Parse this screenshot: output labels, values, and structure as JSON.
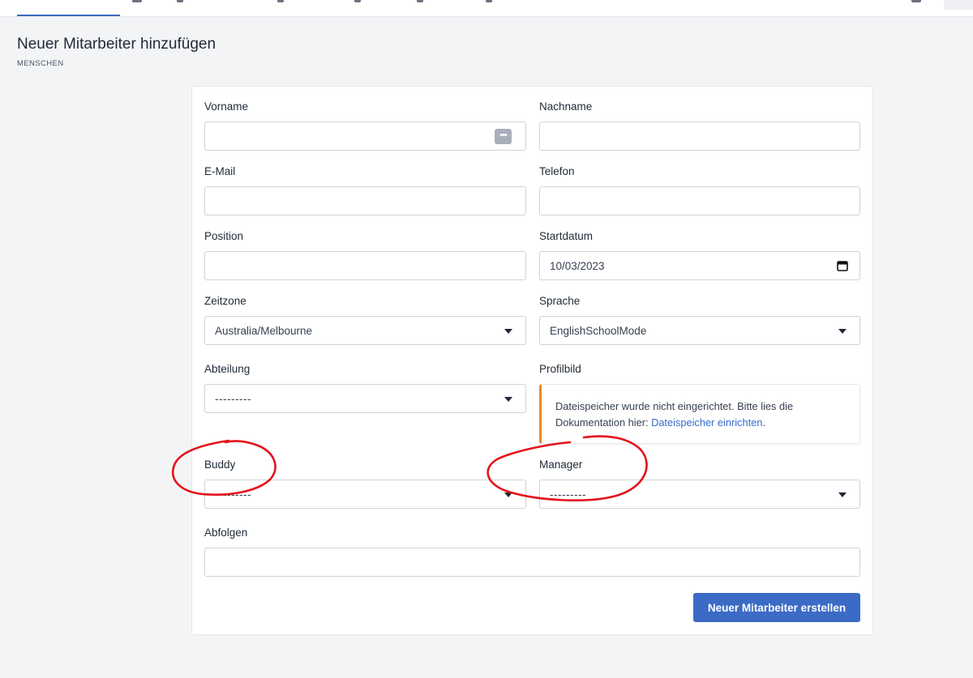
{
  "header": {
    "title": "Neuer Mitarbeiter hinzufügen",
    "breadcrumb": "MENSCHEN"
  },
  "form": {
    "first_name": {
      "label": "Vorname",
      "value": "",
      "icon": "password-manager-icon"
    },
    "last_name": {
      "label": "Nachname",
      "value": ""
    },
    "email": {
      "label": "E-Mail",
      "value": ""
    },
    "phone": {
      "label": "Telefon",
      "value": ""
    },
    "position": {
      "label": "Position",
      "value": ""
    },
    "start_date": {
      "label": "Startdatum",
      "value": "10/03/2023",
      "icon": "calendar-icon"
    },
    "timezone": {
      "label": "Zeitzone",
      "value": "Australia/Melbourne"
    },
    "language": {
      "label": "Sprache",
      "value": "EnglishSchoolMode"
    },
    "department": {
      "label": "Abteilung",
      "value": "---------"
    },
    "profile_picture": {
      "label": "Profilbild",
      "alert_text": "Dateispeicher wurde nicht eingerichtet. Bitte lies die Dokumentation hier: ",
      "alert_link": "Dateispeicher einrichten",
      "alert_end": ".",
      "alert_color": "#e98b1e"
    },
    "buddy": {
      "label": "Buddy",
      "value": "---------"
    },
    "manager": {
      "label": "Manager",
      "value": "---------"
    },
    "sequences": {
      "label": "Abfolgen",
      "value": ""
    },
    "submit_label": "Neuer Mitarbeiter erstellen"
  },
  "colors": {
    "accent": "#3b6bc5",
    "annotation": "#e3131b",
    "warning": "#e98b1e"
  }
}
